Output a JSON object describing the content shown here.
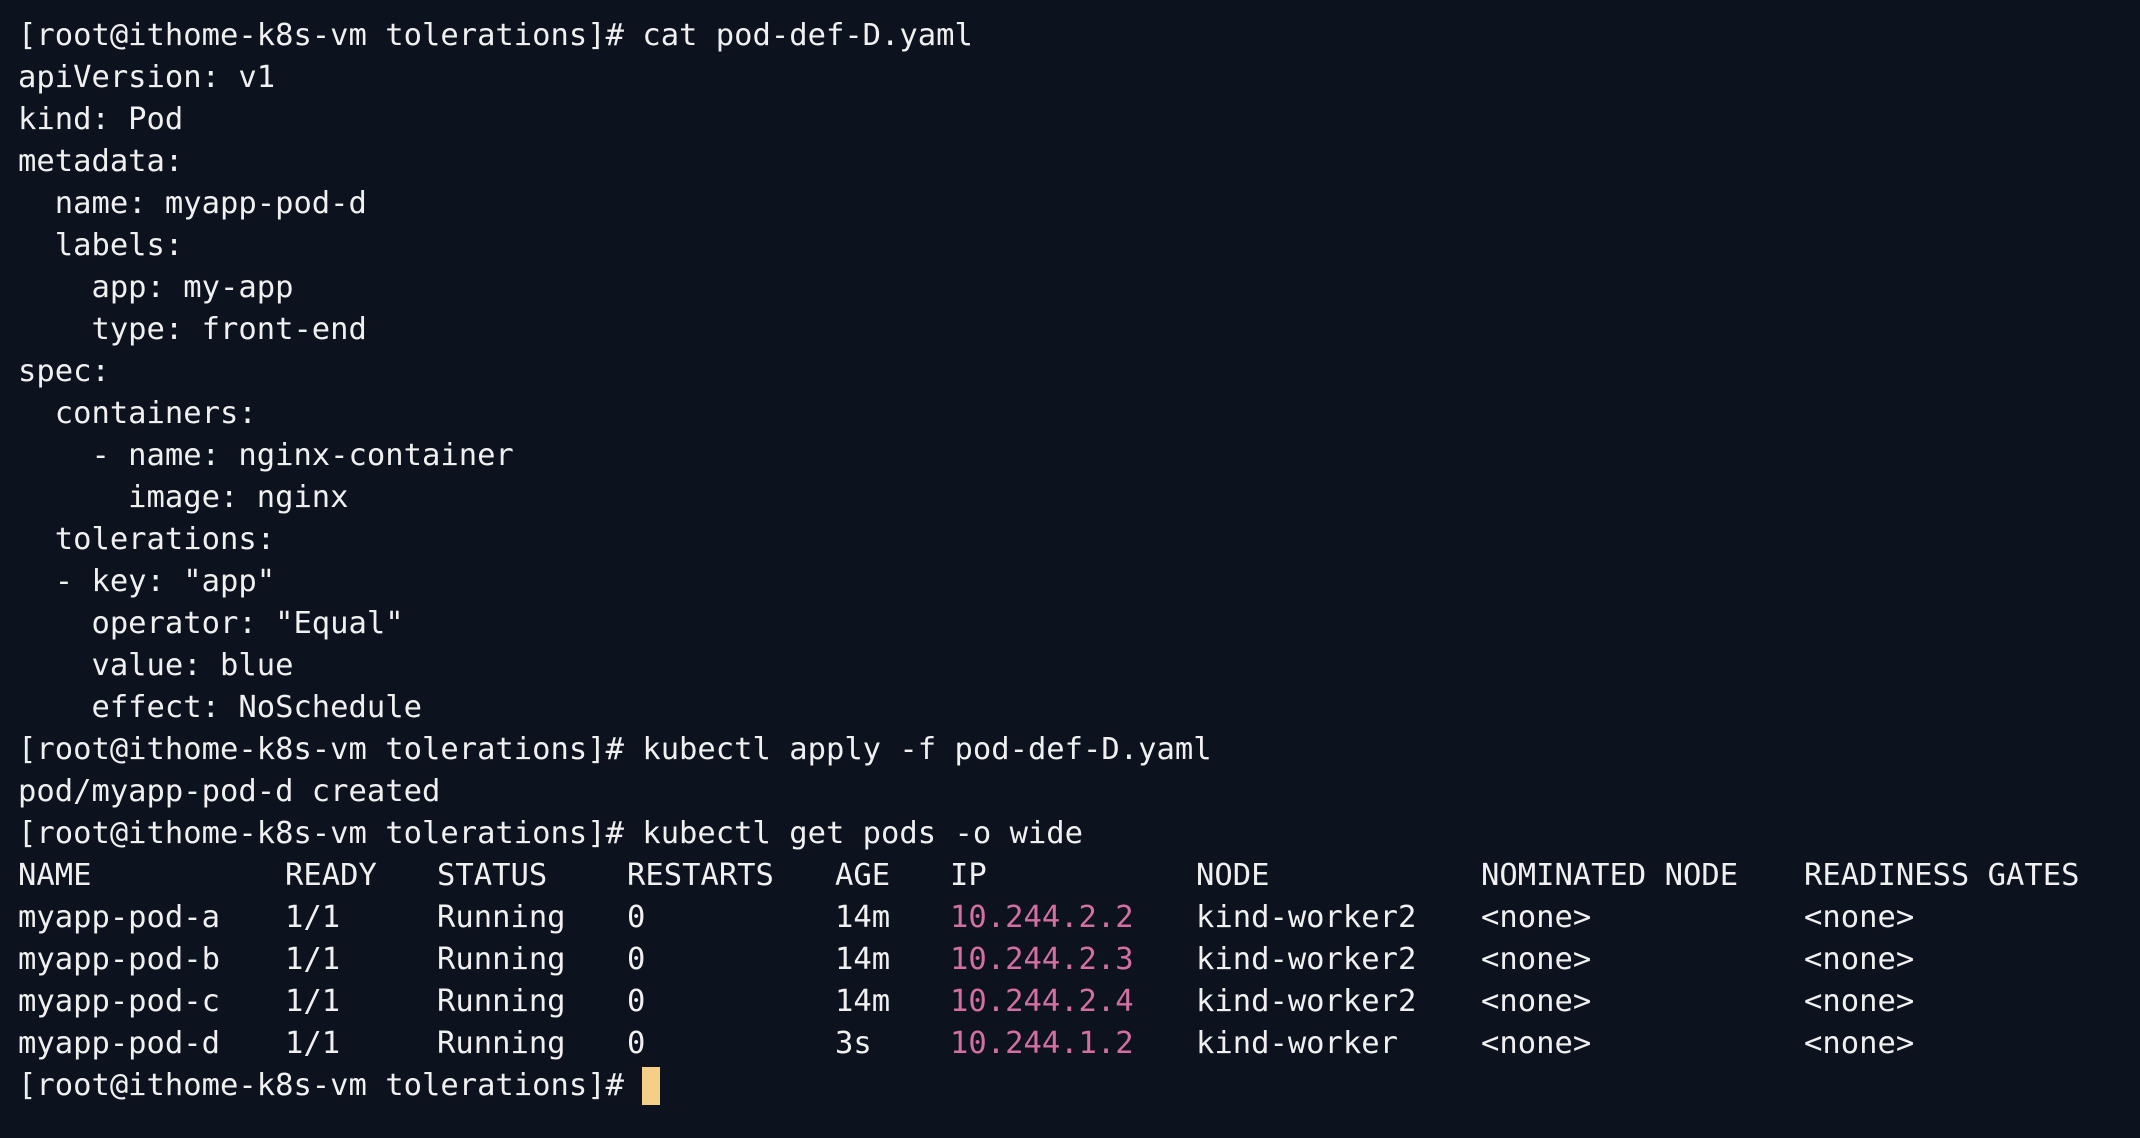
{
  "terminal": {
    "prompt": "[root@ithome-k8s-vm tolerations]# ",
    "cursor_color": "#f5cf87",
    "ip_color": "#d46fa3",
    "background": "#0d131e",
    "cmd1": "cat pod-def-D.yaml",
    "yaml": [
      "apiVersion: v1",
      "kind: Pod",
      "metadata:",
      "  name: myapp-pod-d",
      "  labels:",
      "    app: my-app",
      "    type: front-end",
      "spec:",
      "  containers:",
      "    - name: nginx-container",
      "      image: nginx",
      "  tolerations:",
      "  - key: \"app\"",
      "    operator: \"Equal\"",
      "    value: blue",
      "    effect: NoSchedule"
    ],
    "cmd2": "kubectl apply -f pod-def-D.yaml",
    "apply_output": "pod/myapp-pod-d created",
    "cmd3": "kubectl get pods -o wide",
    "table": {
      "headers": [
        "NAME",
        "READY",
        "STATUS",
        "RESTARTS",
        "AGE",
        "IP",
        "NODE",
        "NOMINATED NODE",
        "READINESS GATES"
      ],
      "rows": [
        [
          "myapp-pod-a",
          "1/1",
          "Running",
          "0",
          "14m",
          "10.244.2.2",
          "kind-worker2",
          "<none>",
          "<none>"
        ],
        [
          "myapp-pod-b",
          "1/1",
          "Running",
          "0",
          "14m",
          "10.244.2.3",
          "kind-worker2",
          "<none>",
          "<none>"
        ],
        [
          "myapp-pod-c",
          "1/1",
          "Running",
          "0",
          "14m",
          "10.244.2.4",
          "kind-worker2",
          "<none>",
          "<none>"
        ],
        [
          "myapp-pod-d",
          "1/1",
          "Running",
          "0",
          "3s",
          "10.244.1.2",
          "kind-worker",
          "<none>",
          "<none>"
        ]
      ]
    }
  }
}
